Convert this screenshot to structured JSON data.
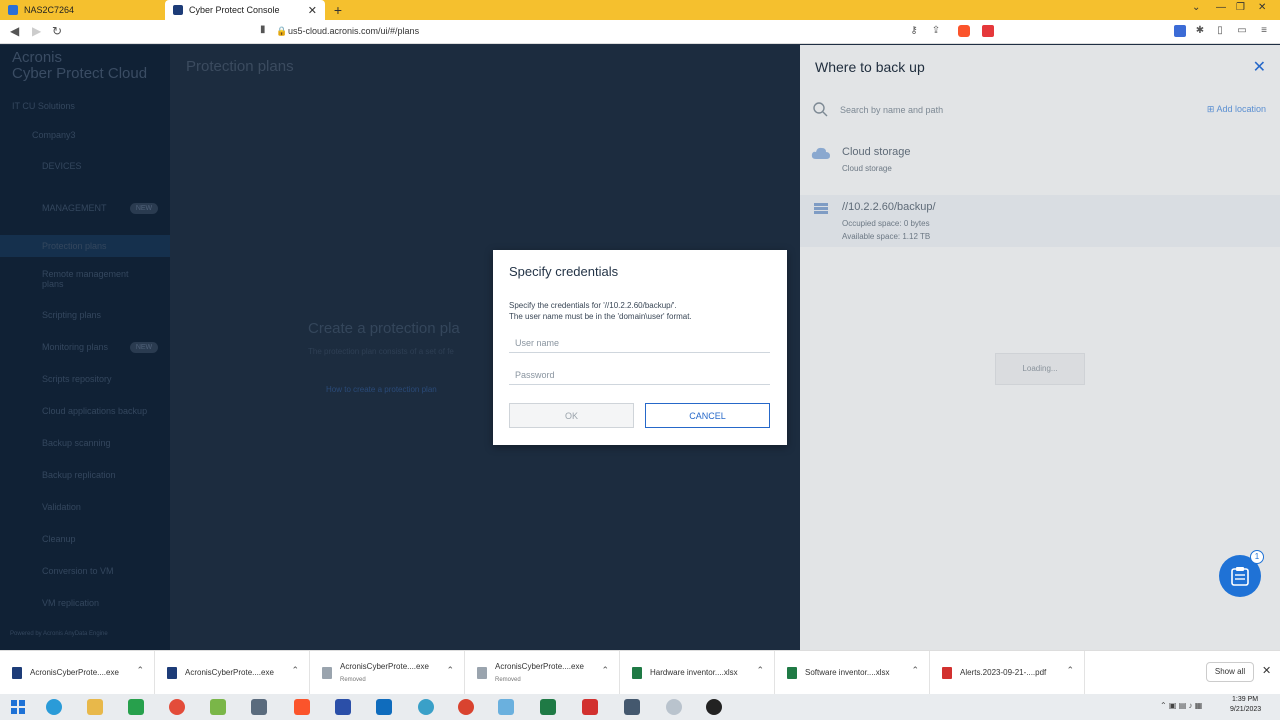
{
  "browser": {
    "tabs": [
      {
        "label": "NAS2C7264"
      },
      {
        "label": "Cyber Protect Console"
      }
    ],
    "url": "us5-cloud.acronis.com/ui/#/plans"
  },
  "sidebar": {
    "brand_line1": "Acronis",
    "brand_line2": "Cyber Protect Cloud",
    "tenant": "IT CU Solutions",
    "company": "Company3",
    "devices": "DEVICES",
    "management": "MANAGEMENT",
    "new_badge": "NEW",
    "items": [
      "Protection plans",
      "Remote management plans",
      "Scripting plans",
      "Monitoring plans",
      "Scripts repository",
      "Cloud applications backup",
      "Backup scanning",
      "Backup replication",
      "Validation",
      "Cleanup",
      "Conversion to VM",
      "VM replication"
    ],
    "footer": "Powered by Acronis AnyData Engine"
  },
  "main": {
    "title": "Protection plans",
    "create_title": "Create a protection pla",
    "create_sub": "The protection plan consists of a set of fe",
    "create_link": "How to create a protection plan"
  },
  "panel": {
    "title": "Where to back up",
    "search_placeholder": "Search by name and path",
    "add_location": "Add location",
    "locations": [
      {
        "title": "Cloud storage",
        "sub1": "Cloud storage"
      },
      {
        "title": "//10.2.2.60/backup/",
        "sub1": "Occupied space: 0 bytes",
        "sub2": "Available space: 1.12 TB"
      }
    ],
    "loading": "Loading..."
  },
  "dialog": {
    "title": "Specify credentials",
    "line1": "Specify the credentials for '//10.2.2.60/backup/'.",
    "line2": "The user name must be in the 'domain\\user' format.",
    "username_placeholder": "User name",
    "password_placeholder": "Password",
    "ok_label": "OK",
    "cancel_label": "CANCEL"
  },
  "chat_badge": "1",
  "downloads": {
    "items": [
      {
        "name": "AcronisCyberProte....exe",
        "sub": ""
      },
      {
        "name": "AcronisCyberProte....exe",
        "sub": ""
      },
      {
        "name": "AcronisCyberProte....exe",
        "sub": "Removed"
      },
      {
        "name": "AcronisCyberProte....exe",
        "sub": "Removed"
      },
      {
        "name": "Hardware inventor....xlsx",
        "sub": ""
      },
      {
        "name": "Software inventor....xlsx",
        "sub": ""
      },
      {
        "name": "Alerts.2023-09-21-....pdf",
        "sub": ""
      }
    ],
    "show_all": "Show all"
  },
  "clock": {
    "time": "1:39 PM",
    "date": "9/21/2023"
  }
}
